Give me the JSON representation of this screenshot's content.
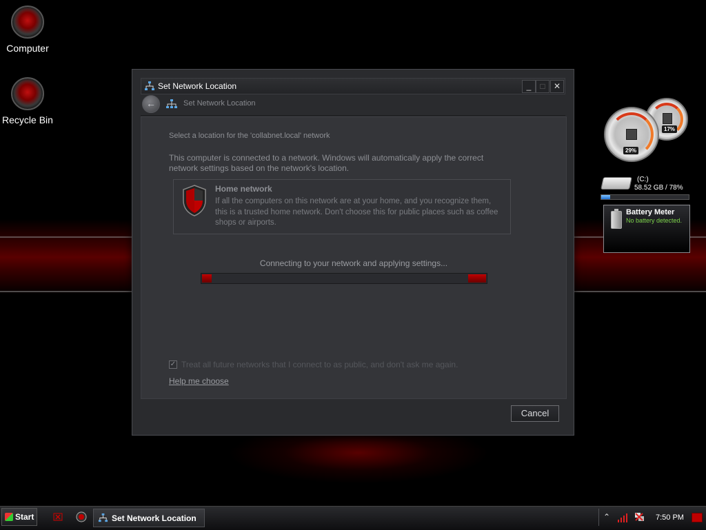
{
  "desktop": {
    "icons": [
      {
        "label": "Computer"
      },
      {
        "label": "Recycle Bin"
      }
    ]
  },
  "window": {
    "title": "Set Network Location",
    "nav_title": "Set Network Location",
    "buttons": {
      "minimize": "_",
      "maximize": "□",
      "close": "✕"
    },
    "back_glyph": "←",
    "intro": "Select a location for the 'collabnet.local' network",
    "description": "This computer is connected to a network. Windows will automatically apply the correct network settings based on the network's location.",
    "option": {
      "title": "Home network",
      "description": "If all the computers on this network are at your home, and you recognize them, this is a trusted home network.  Don't choose this for public places such as coffee shops or airports."
    },
    "progress_label": "Connecting to your network and applying settings...",
    "checkbox": {
      "label": "Treat all future networks that I connect to as public, and don't ask me again.",
      "checked": true,
      "glyph": "✓"
    },
    "help_link": "Help me choose",
    "cancel_label": "Cancel"
  },
  "gadgets": {
    "cpu_meter": {
      "cpu_percent": "29%",
      "memory_percent": "17%"
    },
    "drive": {
      "label": "(C:)",
      "stats": "58.52 GB / 78%",
      "fill_fraction": 0.1
    },
    "battery": {
      "title": "Battery Meter",
      "status": "No battery detected."
    }
  },
  "taskbar": {
    "start_label": "Start",
    "task_label": "Set Network Location",
    "tray_chevron": "⌃",
    "clock": "7:50 PM"
  },
  "colors": {
    "accent_red": "#c00000",
    "window_bg": "#2a2b2e",
    "battery_status": "#7cd34a"
  },
  "icons": [
    "computer-icon",
    "recycle-bin-icon",
    "network-icon",
    "shield-icon",
    "battery-icon",
    "drive-icon",
    "signal-icon",
    "network-tray-icon",
    "windows-flag-icon"
  ]
}
